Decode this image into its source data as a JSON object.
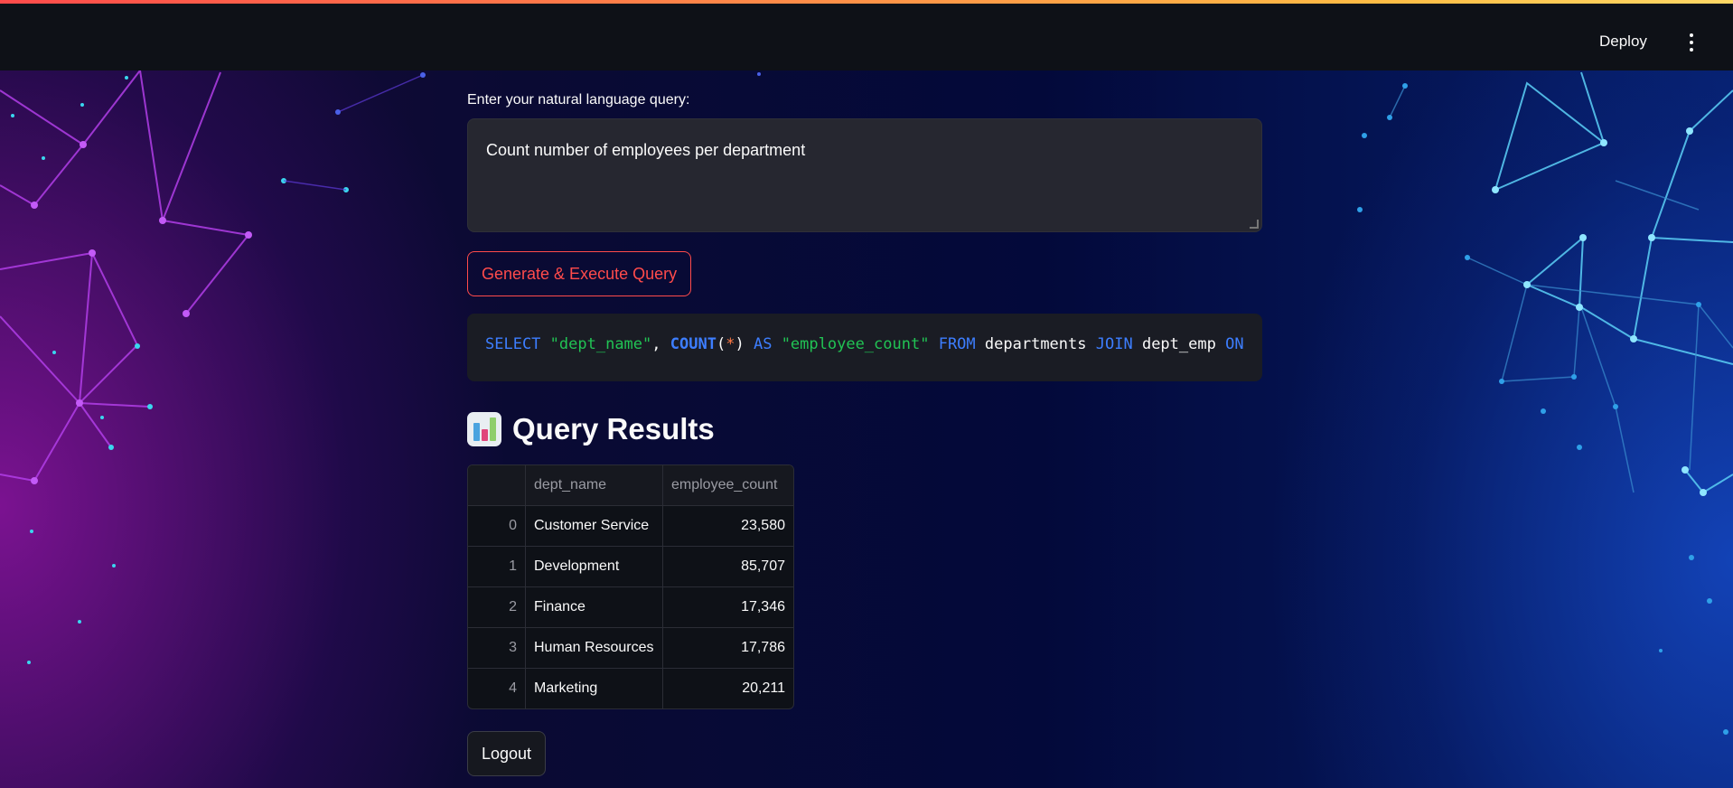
{
  "header": {
    "deploy_label": "Deploy",
    "menu_icon": "kebab-menu-icon"
  },
  "query": {
    "label": "Enter your natural language query:",
    "value": "Count number of employees per department"
  },
  "generate_button": "Generate & Execute Query",
  "sql": {
    "t1": "SELECT",
    "t2": "\"dept_name\"",
    "t3": ",",
    "t4": "COUNT",
    "t5": "(",
    "t6": "*",
    "t7": ")",
    "t8": "AS",
    "t9": "\"employee_count\"",
    "t10": "FROM",
    "t11": "departments",
    "t12": "JOIN",
    "t13": "dept_emp",
    "t14": "ON"
  },
  "results": {
    "icon": "bar-chart-icon",
    "title": "Query Results",
    "columns": [
      "",
      "dept_name",
      "employee_count"
    ],
    "rows": [
      {
        "index": "0",
        "dept_name": "Customer Service",
        "employee_count": "23,580"
      },
      {
        "index": "1",
        "dept_name": "Development",
        "employee_count": "85,707"
      },
      {
        "index": "2",
        "dept_name": "Finance",
        "employee_count": "17,346"
      },
      {
        "index": "3",
        "dept_name": "Human Resources",
        "employee_count": "17,786"
      },
      {
        "index": "4",
        "dept_name": "Marketing",
        "employee_count": "20,211"
      }
    ]
  },
  "logout_button": "Logout",
  "colors": {
    "accent": "#ff4b4b",
    "sql_keyword": "#3d7eff",
    "sql_string": "#21c354",
    "topbar": "#0e1117"
  }
}
